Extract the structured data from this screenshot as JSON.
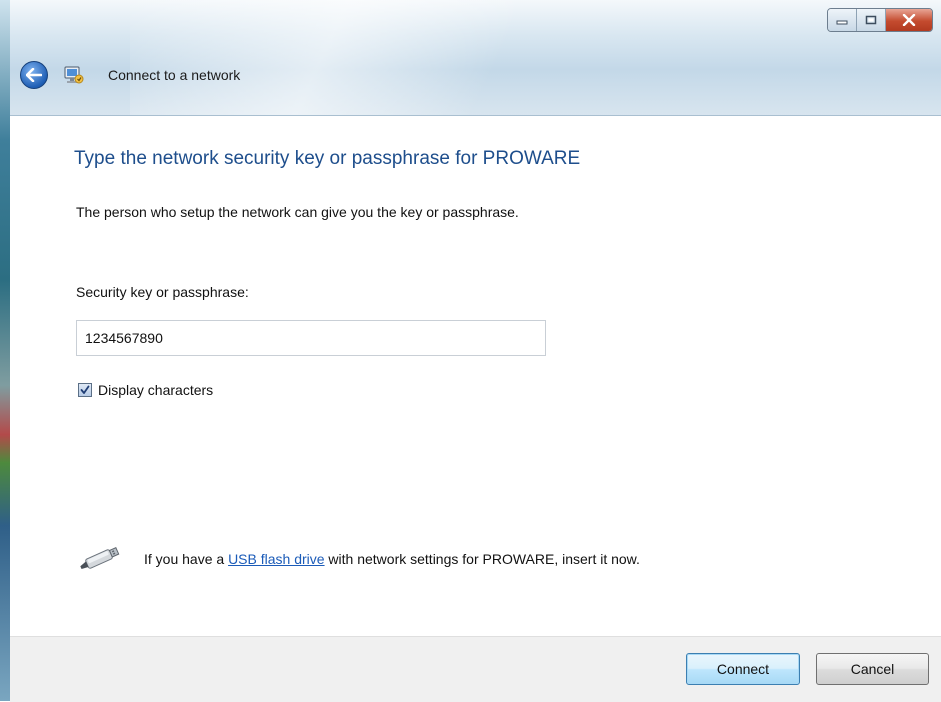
{
  "window": {
    "title": "Connect to a network",
    "controls": {
      "minimize_icon": "minimize-icon",
      "maximize_icon": "maximize-icon",
      "close_icon": "close-icon"
    }
  },
  "content": {
    "heading": "Type the network security key or passphrase for PROWARE",
    "subtext": "The person who setup the network can give you the key or passphrase.",
    "field_label": "Security key or passphrase:",
    "key_value": "1234567890",
    "display_characters": {
      "label": "Display characters",
      "checked": true
    },
    "usb": {
      "prefix": "If you have a ",
      "link_text": "USB flash drive",
      "suffix": " with network settings for PROWARE, insert it now."
    }
  },
  "footer": {
    "connect_label": "Connect",
    "cancel_label": "Cancel"
  },
  "colors": {
    "heading": "#1e4e8c",
    "link": "#1b5bb8",
    "default_button_border": "#3c7fb1"
  }
}
